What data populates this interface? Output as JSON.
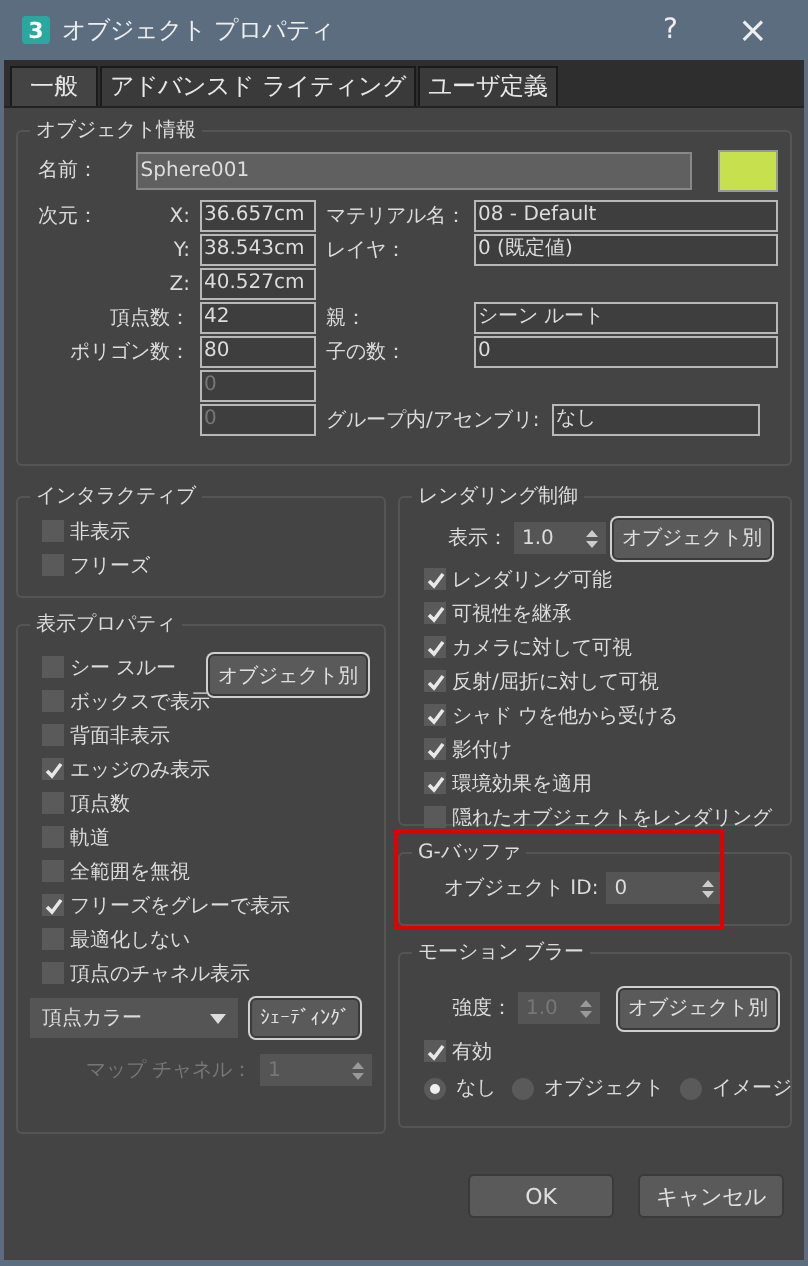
{
  "window": {
    "icon_text": "3",
    "title": "オブジェクト プロパティ",
    "help": "?",
    "close": "×"
  },
  "tabs": [
    {
      "label": "一般",
      "selected": true
    },
    {
      "label": "アドバンスド ライティング",
      "selected": false
    },
    {
      "label": "ユーザ定義",
      "selected": false
    }
  ],
  "object_info": {
    "title": "オブジェクト情報",
    "name_label": "名前：",
    "name": "Sphere001",
    "dims_label": "次元：",
    "rows": [
      {
        "label": "X:",
        "value": "36.657cm",
        "label2": "マテリアル名：",
        "value2": "08 - Default"
      },
      {
        "label": "Y:",
        "value": "38.543cm",
        "label2": "レイヤ：",
        "value2": "0 (既定値)"
      },
      {
        "label": "Z:",
        "value": "40.527cm"
      },
      {
        "label": "頂点数：",
        "value": "42",
        "label2": "親：",
        "value2": "シーン ルート"
      },
      {
        "label": "ポリゴン数：",
        "value": "80",
        "label2": "子の数：",
        "value2": "0"
      },
      {
        "value": "0",
        "disabled": true
      },
      {
        "value": "0",
        "disabled": true,
        "label2": "グループ内/アセンブリ:",
        "value2": "なし"
      }
    ]
  },
  "interactive": {
    "title": "インタラクティブ",
    "items": [
      {
        "label": "非表示",
        "checked": false
      },
      {
        "label": "フリーズ",
        "checked": false
      }
    ]
  },
  "display": {
    "title": "表示プロパティ",
    "by_object_button": "オブジェクト別",
    "items": [
      {
        "label": "シー スルー",
        "checked": false
      },
      {
        "label": "ボックスで表示",
        "checked": false
      },
      {
        "label": "背面非表示",
        "checked": false
      },
      {
        "label": "エッジのみ表示",
        "checked": true
      },
      {
        "label": "頂点数",
        "checked": false
      },
      {
        "label": "軌道",
        "checked": false
      },
      {
        "label": "全範囲を無視",
        "checked": false
      },
      {
        "label": "フリーズをグレーで表示",
        "checked": true
      },
      {
        "label": "最適化しない",
        "checked": false
      },
      {
        "label": "頂点のチャネル表示",
        "checked": false
      }
    ],
    "dropdown": "頂点カラー",
    "shading_button": "ｼｪｰﾃﾞｨﾝｸﾞ",
    "map_channel": {
      "label": "マップ チャネル：",
      "value": "1",
      "disabled": true
    }
  },
  "rendering": {
    "title": "レンダリング制御",
    "visibility_label": "表示：",
    "visibility": "1.0",
    "by_object_button": "オブジェクト別",
    "items": [
      {
        "label": "レンダリング可能",
        "checked": true
      },
      {
        "label": "可視性を継承",
        "checked": true
      },
      {
        "label": "カメラに対して可視",
        "checked": true
      },
      {
        "label": "反射/屈折に対して可視",
        "checked": true
      },
      {
        "label": "シャド ウを他から受ける",
        "checked": true
      },
      {
        "label": "影付け",
        "checked": true
      },
      {
        "label": "環境効果を適用",
        "checked": true
      },
      {
        "label": "隠れたオブジェクトをレンダリング",
        "checked": false
      }
    ]
  },
  "gbuffer": {
    "title": "G-バッファ",
    "id_label": "オブジェクト ID:",
    "id": "0",
    "highlighted": true
  },
  "motion_blur": {
    "title": "モーション ブラー",
    "strength_label": "強度：",
    "strength": "1.0",
    "strength_disabled": true,
    "by_object_button": "オブジェクト別",
    "enabled": {
      "label": "有効",
      "checked": true
    },
    "modes": [
      {
        "label": "なし",
        "selected": true
      },
      {
        "label": "オブジェクト",
        "selected": false
      },
      {
        "label": "イメージ",
        "selected": false
      }
    ]
  },
  "buttons": [
    "OK",
    "キャンセル"
  ]
}
